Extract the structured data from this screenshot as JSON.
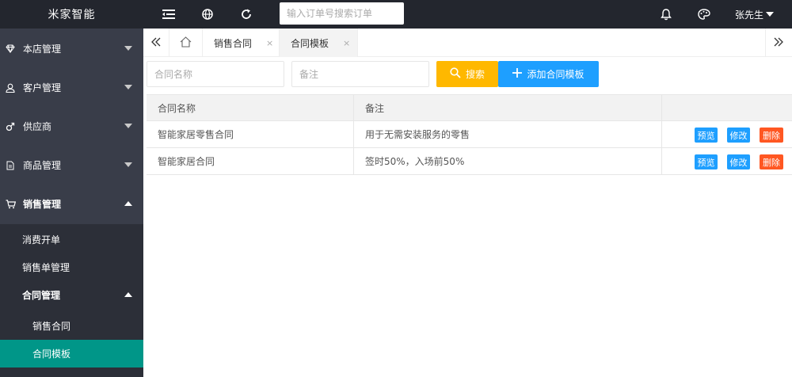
{
  "app": {
    "logo": "米家智能"
  },
  "topbar": {
    "search_placeholder": "输入订单号搜索订单",
    "user_name": "张先生"
  },
  "sidebar": {
    "items": [
      {
        "label": "本店管理",
        "icon": "diamond-icon"
      },
      {
        "label": "客户管理",
        "icon": "user-icon"
      },
      {
        "label": "供应商",
        "icon": "male-icon"
      },
      {
        "label": "商品管理",
        "icon": "document-icon"
      },
      {
        "label": "销售管理",
        "icon": "cart-icon"
      }
    ],
    "sub_items": [
      {
        "label": "消费开单"
      },
      {
        "label": "销售单管理"
      },
      {
        "label": "合同管理"
      },
      {
        "label": "销售合同"
      },
      {
        "label": "合同模板"
      }
    ]
  },
  "tabs": [
    {
      "label": "销售合同",
      "close": "×"
    },
    {
      "label": "合同模板",
      "close": "×"
    }
  ],
  "toolbar": {
    "name_placeholder": "合同名称",
    "remark_placeholder": "备注",
    "search_label": "搜索",
    "add_label": "添加合同模板"
  },
  "table": {
    "headers": [
      "合同名称",
      "备注",
      ""
    ],
    "rows": [
      {
        "name": "智能家居零售合同",
        "remark": "用于无需安装服务的零售"
      },
      {
        "name": "智能家居合同",
        "remark": "签时50%，入场前50%"
      }
    ],
    "actions": {
      "preview": "预览",
      "edit": "修改",
      "delete": "删除"
    }
  },
  "colors": {
    "topbar": "#23262e",
    "sidebar": "#393d49",
    "active": "#009688",
    "warm": "#ffb800",
    "normal": "#1e9fff",
    "danger": "#ff5722"
  }
}
